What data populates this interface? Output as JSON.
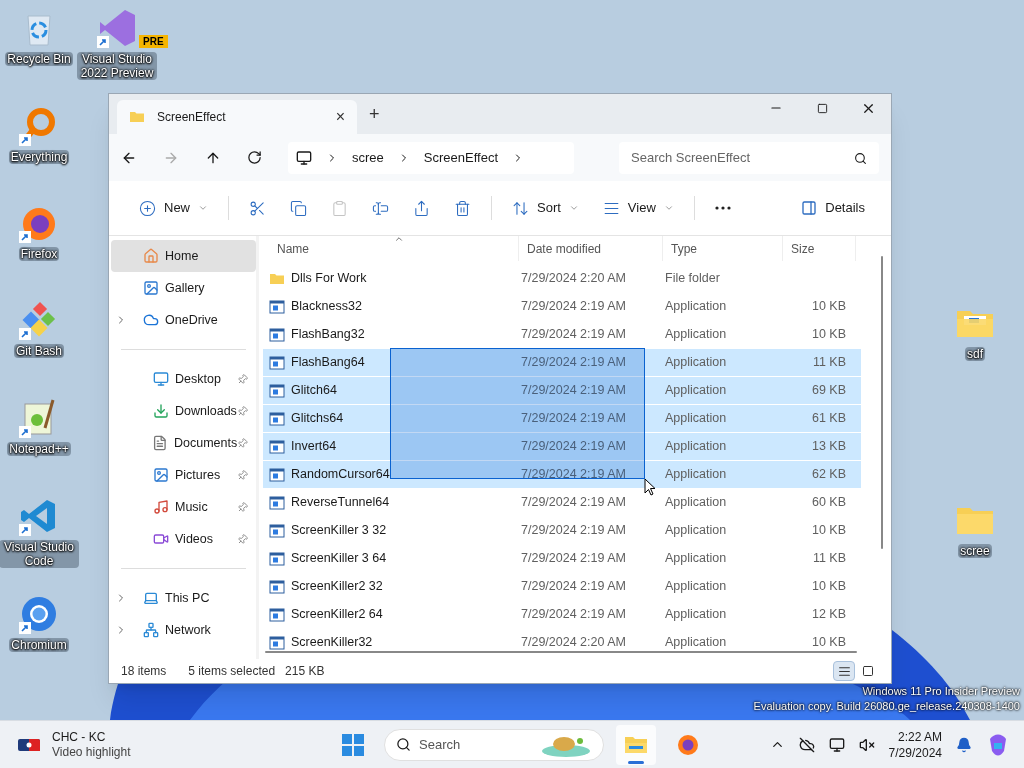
{
  "desktop": {
    "left_column": [
      {
        "label": "Recycle Bin",
        "kind": "recycle",
        "shortcut": false
      },
      {
        "label": "Everything",
        "kind": "everything",
        "shortcut": true
      },
      {
        "label": "Firefox",
        "kind": "firefox",
        "shortcut": true
      },
      {
        "label": "Git Bash",
        "kind": "gitbash",
        "shortcut": true
      },
      {
        "label": "Notepad++",
        "kind": "notepad",
        "shortcut": true
      },
      {
        "label": "Visual Studio Code",
        "kind": "vscode",
        "shortcut": true
      },
      {
        "label": "Chromium",
        "kind": "chromium",
        "shortcut": true
      }
    ],
    "second_column": [
      {
        "label": "Visual Studio 2022 Preview",
        "kind": "vspreview",
        "shortcut": true,
        "badge": "PRE"
      }
    ],
    "right_column": [
      {
        "label": "sdf",
        "kind": "folderdoc",
        "shortcut": false
      },
      {
        "label": "scree",
        "kind": "folder",
        "shortcut": false
      }
    ],
    "watermark": [
      "Windows 11 Pro Insider Preview",
      "Evaluation copy. Build 26080.ge_release.240308-1400"
    ]
  },
  "window": {
    "tab": {
      "title": "ScreenEffect",
      "close": "×"
    },
    "new_tab": "+",
    "address": {
      "crumbs": [
        "scree",
        "ScreenEffect"
      ]
    },
    "search": {
      "placeholder": "Search ScreenEffect"
    },
    "toolbar": [
      {
        "kind": "new",
        "label": "New",
        "dropdown": true,
        "disabled": false
      },
      {
        "kind": "cut",
        "disabled": false
      },
      {
        "kind": "copy",
        "disabled": false
      },
      {
        "kind": "paste",
        "disabled": true
      },
      {
        "kind": "rename",
        "disabled": false
      },
      {
        "kind": "share",
        "disabled": false
      },
      {
        "kind": "delete",
        "disabled": false
      },
      {
        "kind": "sort",
        "label": "Sort",
        "dropdown": true,
        "disabled": false
      },
      {
        "kind": "view",
        "label": "View",
        "dropdown": true,
        "disabled": false
      },
      {
        "kind": "more",
        "disabled": false
      }
    ],
    "details": "Details",
    "sidebar": [
      {
        "items": [
          {
            "kind": "home",
            "label": "Home",
            "selected": true,
            "expandable": false,
            "pinned": false
          },
          {
            "kind": "gallery",
            "label": "Gallery",
            "selected": false,
            "expandable": false,
            "pinned": false
          },
          {
            "kind": "onedrive",
            "label": "OneDrive",
            "selected": false,
            "expandable": true,
            "pinned": false
          }
        ]
      },
      {
        "items": [
          {
            "kind": "desktop",
            "label": "Desktop",
            "selected": false,
            "expandable": false,
            "pinned": true
          },
          {
            "kind": "downloads",
            "label": "Downloads",
            "selected": false,
            "expandable": false,
            "pinned": true
          },
          {
            "kind": "documents",
            "label": "Documents",
            "selected": false,
            "expandable": false,
            "pinned": true
          },
          {
            "kind": "pictures",
            "label": "Pictures",
            "selected": false,
            "expandable": false,
            "pinned": true
          },
          {
            "kind": "music",
            "label": "Music",
            "selected": false,
            "expandable": false,
            "pinned": true
          },
          {
            "kind": "videos",
            "label": "Videos",
            "selected": false,
            "expandable": false,
            "pinned": true
          }
        ]
      },
      {
        "items": [
          {
            "kind": "thispc",
            "label": "This PC",
            "selected": false,
            "expandable": true,
            "pinned": false
          },
          {
            "kind": "network",
            "label": "Network",
            "selected": false,
            "expandable": true,
            "pinned": false
          }
        ]
      }
    ],
    "columns": [
      {
        "label": "Name",
        "sorted": true
      },
      {
        "label": "Date modified",
        "sorted": false
      },
      {
        "label": "Type",
        "sorted": false
      },
      {
        "label": "Size",
        "sorted": false
      }
    ],
    "rows": [
      {
        "kind": "folder",
        "name": "Dlls For Work",
        "date": "7/29/2024 2:20 AM",
        "type": "File folder",
        "size": "",
        "selected": false
      },
      {
        "kind": "app",
        "name": "Blackness32",
        "date": "7/29/2024 2:19 AM",
        "type": "Application",
        "size": "10 KB",
        "selected": false
      },
      {
        "kind": "app",
        "name": "FlashBang32",
        "date": "7/29/2024 2:19 AM",
        "type": "Application",
        "size": "10 KB",
        "selected": false
      },
      {
        "kind": "app",
        "name": "FlashBang64",
        "date": "7/29/2024 2:19 AM",
        "type": "Application",
        "size": "11 KB",
        "selected": true
      },
      {
        "kind": "app",
        "name": "Glitch64",
        "date": "7/29/2024 2:19 AM",
        "type": "Application",
        "size": "69 KB",
        "selected": true
      },
      {
        "kind": "app",
        "name": "Glitchs64",
        "date": "7/29/2024 2:19 AM",
        "type": "Application",
        "size": "61 KB",
        "selected": true
      },
      {
        "kind": "app",
        "name": "Invert64",
        "date": "7/29/2024 2:19 AM",
        "type": "Application",
        "size": "13 KB",
        "selected": true
      },
      {
        "kind": "app",
        "name": "RandomCursor64",
        "date": "7/29/2024 2:19 AM",
        "type": "Application",
        "size": "62 KB",
        "selected": true
      },
      {
        "kind": "app",
        "name": "ReverseTunnel64",
        "date": "7/29/2024 2:19 AM",
        "type": "Application",
        "size": "60 KB",
        "selected": false
      },
      {
        "kind": "app",
        "name": "ScreenKiller 3 32",
        "date": "7/29/2024 2:19 AM",
        "type": "Application",
        "size": "10 KB",
        "selected": false
      },
      {
        "kind": "app",
        "name": "ScreenKiller 3 64",
        "date": "7/29/2024 2:19 AM",
        "type": "Application",
        "size": "11 KB",
        "selected": false
      },
      {
        "kind": "app",
        "name": "ScreenKiller2 32",
        "date": "7/29/2024 2:19 AM",
        "type": "Application",
        "size": "10 KB",
        "selected": false
      },
      {
        "kind": "app",
        "name": "ScreenKiller2 64",
        "date": "7/29/2024 2:19 AM",
        "type": "Application",
        "size": "12 KB",
        "selected": false
      },
      {
        "kind": "app",
        "name": "ScreenKiller32",
        "date": "7/29/2024 2:20 AM",
        "type": "Application",
        "size": "10 KB",
        "selected": false
      }
    ],
    "status": {
      "count": "18 items",
      "selection": "5 items selected",
      "size": "215 KB"
    },
    "view_modes": [
      {
        "kind": "details",
        "selected": true
      },
      {
        "kind": "tiles",
        "selected": false
      }
    ]
  },
  "taskbar": {
    "widget": {
      "title": "CHC - KC",
      "subtitle": "Video highlight"
    },
    "search": {
      "placeholder": "Search"
    },
    "apps": [
      {
        "kind": "explorer",
        "active": true
      },
      {
        "kind": "firefox",
        "active": false
      }
    ],
    "time": "2:22 AM",
    "date": "7/29/2024"
  }
}
